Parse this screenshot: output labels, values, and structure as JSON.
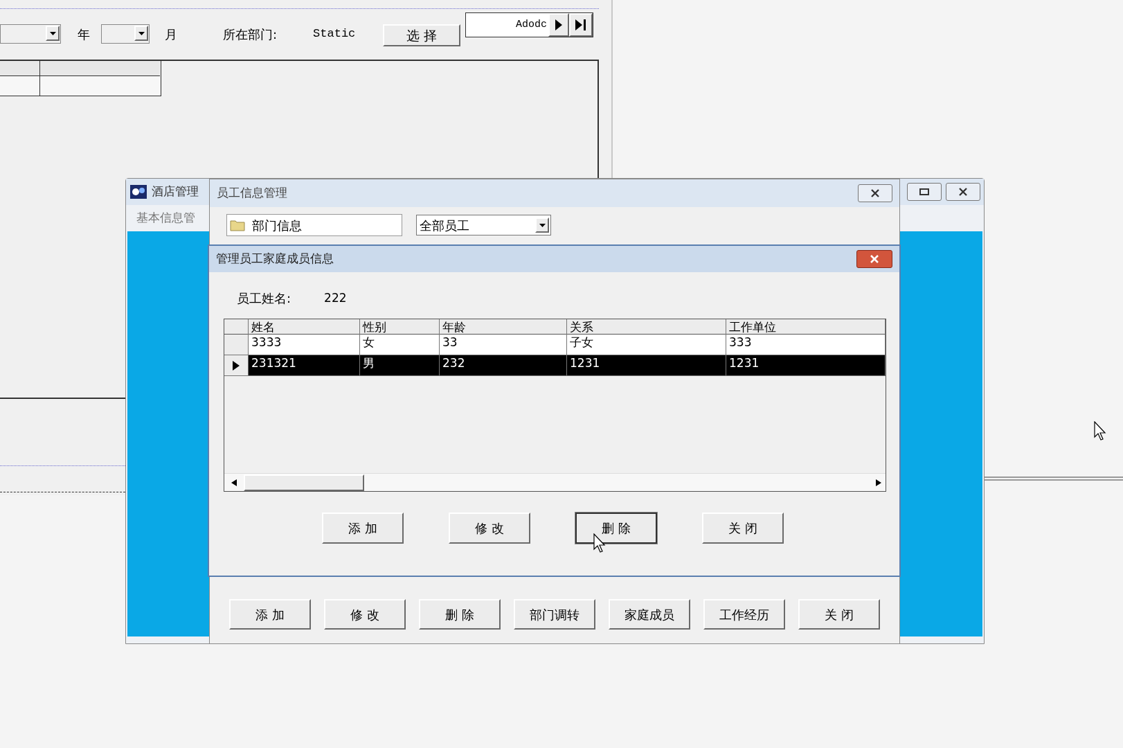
{
  "background_window": {
    "year_label": "年",
    "month_label": "月",
    "department_label": "所在部门:",
    "department_value": "Static",
    "select_button": "选 择",
    "data_control": {
      "caption": "Adodc"
    }
  },
  "main_window": {
    "title": "酒店管理",
    "menu": [
      "基本信息管"
    ]
  },
  "employee_window": {
    "title": "员工信息管理",
    "department_field": "部门信息",
    "filter": "全部员工",
    "buttons": [
      "添 加",
      "修 改",
      "删 除",
      "部门调转",
      "家庭成员",
      "工作经历",
      "关 闭"
    ]
  },
  "family_dialog": {
    "title": "管理员工家庭成员信息",
    "employee_label": "员工姓名:",
    "employee_name": "222",
    "table": {
      "columns": [
        "姓名",
        "性别",
        "年龄",
        "关系",
        "工作单位"
      ],
      "rows": [
        {
          "cells": [
            "3333",
            "女",
            "33",
            "子女",
            "333"
          ],
          "selected": false
        },
        {
          "cells": [
            "231321",
            "男",
            "232",
            "1231",
            "1231"
          ],
          "selected": true
        }
      ]
    },
    "buttons": [
      {
        "label": "添 加",
        "focused": false
      },
      {
        "label": "修 改",
        "focused": false
      },
      {
        "label": "删 除",
        "focused": true
      },
      {
        "label": "关 闭",
        "focused": false
      }
    ]
  }
}
